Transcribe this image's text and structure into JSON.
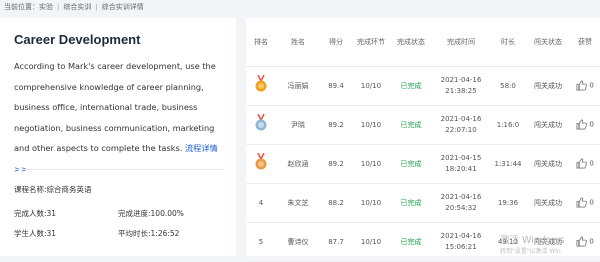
{
  "breadcrumb": {
    "prefix": "当前位置：",
    "items": [
      "实验",
      "综合实训",
      "综合实训详情"
    ]
  },
  "course": {
    "title": "Career Development",
    "description": "According to Mark's career development, use the comprehensive knowledge of career planning, business office, international trade, business negotiation, business communication, marketing and other aspects to complete the tasks.",
    "more_link": "流程详情 >>",
    "name_line": "课程名称:综合商务英语",
    "completed_count": "完成人数:31",
    "completion_rate": "完成进度:100.00%",
    "student_count": "学生人数:31",
    "avg_duration": "平均时长:1:26:52"
  },
  "table": {
    "headers": [
      "排名",
      "姓名",
      "得分",
      "完成环节",
      "完成状态",
      "完成时间",
      "时长",
      "闯关状态",
      "获赞"
    ],
    "rows": [
      {
        "rank_icon": "gold-medal-icon",
        "rank_color": "#f0a020",
        "name": "冯丽娟",
        "score": "89.4",
        "steps": "10/10",
        "status": "已完成",
        "date": "2021-04-16",
        "time": "21:38:25",
        "duration": "58:0",
        "result": "闯关成功",
        "likes": "0"
      },
      {
        "rank_icon": "silver-medal-icon",
        "rank_color": "#8fb8d8",
        "name": "尹晓",
        "score": "89.2",
        "steps": "10/10",
        "status": "已完成",
        "date": "2021-04-16",
        "time": "22:07:10",
        "duration": "1:16:0",
        "result": "闯关成功",
        "likes": "0"
      },
      {
        "rank_icon": "bronze-medal-icon",
        "rank_color": "#e89a40",
        "name": "赵欣涵",
        "score": "89.2",
        "steps": "10/10",
        "status": "已完成",
        "date": "2021-04-15",
        "time": "18:20:41",
        "duration": "1:31:44",
        "result": "闯关成功",
        "likes": "0"
      },
      {
        "rank": "4",
        "name": "朱文芝",
        "score": "88.2",
        "steps": "10/10",
        "status": "已完成",
        "date": "2021-04-16",
        "time": "20:54:32",
        "duration": "19:36",
        "result": "闯关成功",
        "likes": "0"
      },
      {
        "rank": "5",
        "name": "曹诗仪",
        "score": "87.7",
        "steps": "10/10",
        "status": "已完成",
        "date": "2021-04-16",
        "time": "15:06:21",
        "duration": "49:12",
        "result": "闯关成功",
        "likes": "0"
      }
    ]
  },
  "watermark": {
    "line1": "激活 Windows",
    "line2": "转到\"设置\"以激活 Win"
  }
}
